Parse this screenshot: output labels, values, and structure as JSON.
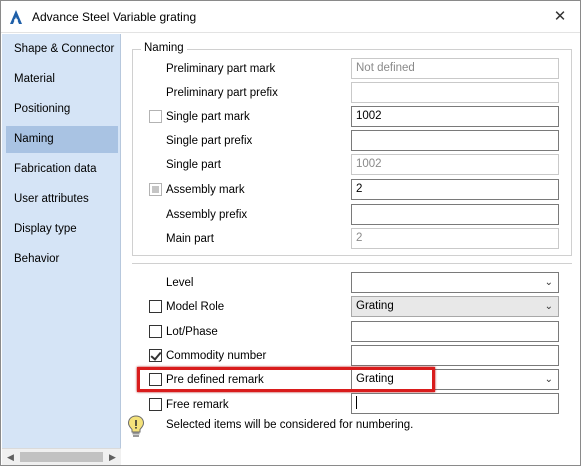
{
  "titlebar": {
    "app_name": "Advance Steel",
    "doc_title": "Variable grating",
    "close_glyph": "✕"
  },
  "sidebar": {
    "items": [
      {
        "label": "Shape & Connector"
      },
      {
        "label": "Material"
      },
      {
        "label": "Positioning"
      },
      {
        "label": "Naming",
        "active": true
      },
      {
        "label": "Fabrication data"
      },
      {
        "label": "User attributes"
      },
      {
        "label": "Display type"
      },
      {
        "label": "Behavior"
      }
    ]
  },
  "naming_group": {
    "title": "Naming",
    "preliminary_part_mark": {
      "label": "Preliminary part mark",
      "value": "Not defined"
    },
    "preliminary_part_prefix": {
      "label": "Preliminary part prefix",
      "value": ""
    },
    "single_part_mark": {
      "label": "Single part mark",
      "value": "1002"
    },
    "single_part_prefix": {
      "label": "Single part prefix",
      "value": ""
    },
    "single_part": {
      "label": "Single part",
      "value": "1002"
    },
    "assembly_mark": {
      "label": "Assembly mark",
      "value": "2"
    },
    "assembly_prefix": {
      "label": "Assembly prefix",
      "value": ""
    },
    "main_part": {
      "label": "Main part",
      "value": "2"
    }
  },
  "attributes": {
    "level": {
      "label": "Level",
      "value": ""
    },
    "model_role": {
      "label": "Model Role",
      "value": "Grating"
    },
    "lot_phase": {
      "label": "Lot/Phase",
      "value": ""
    },
    "commodity_number": {
      "label": "Commodity number",
      "value": "",
      "checked": true
    },
    "pre_defined_remark": {
      "label": "Pre defined remark",
      "value": "Grating"
    },
    "free_remark": {
      "label": "Free remark",
      "value": ""
    }
  },
  "hint": {
    "text": "Selected items will be considered for numbering.",
    "icon": "lightbulb-icon"
  },
  "colors": {
    "highlight": "#d91c1c",
    "sidebar_bg": "#d5e4f6",
    "sidebar_active": "#a9c3e3"
  }
}
